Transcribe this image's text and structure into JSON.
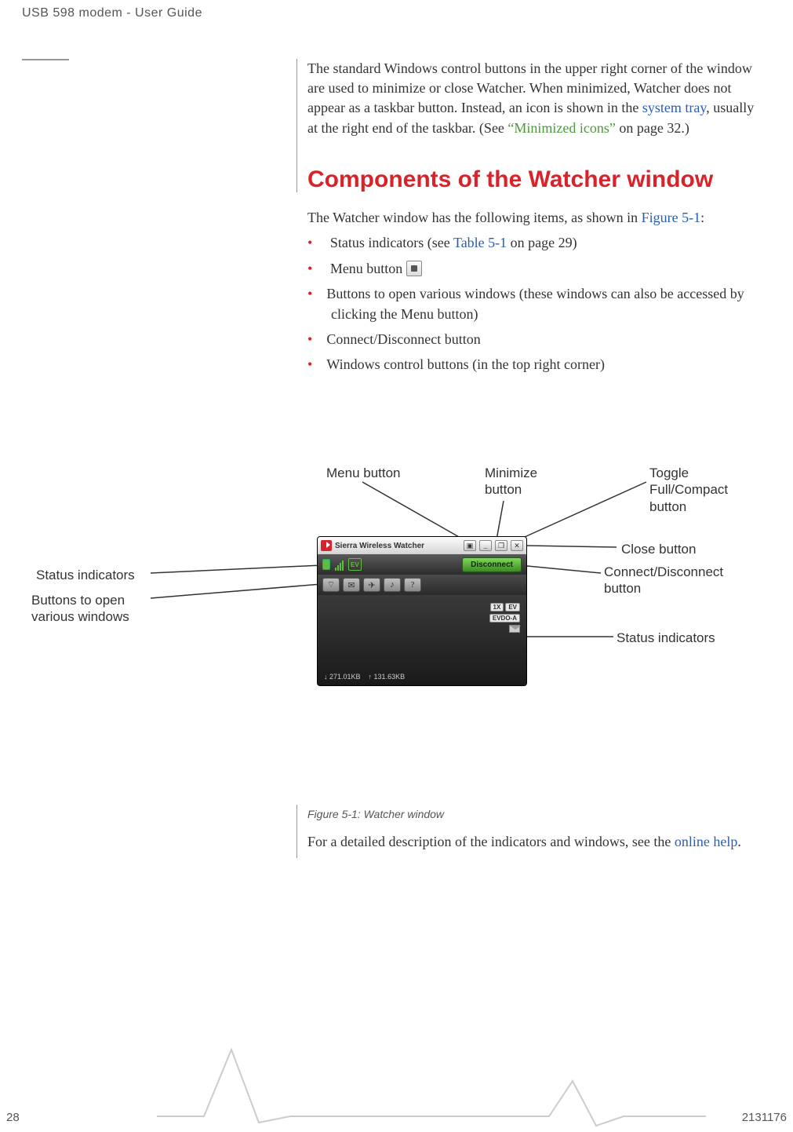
{
  "header": {
    "title": "USB 598 modem - User Guide"
  },
  "intro": {
    "p1a": "The standard Windows control buttons in the upper right corner of the window are used to minimize or close Watcher. When minimized, Watcher does not appear as a taskbar button. Instead, an icon is shown in the ",
    "link1": "system tray",
    "p1b": ", usually at the right end of the taskbar. (See ",
    "link2": "“Minimized icons”",
    "p1c": " on page 32.)"
  },
  "h1": "Components of the Watcher window",
  "lead": {
    "a": "The Watcher window has the following items, as shown in ",
    "link": "Figure 5-1",
    "b": ":"
  },
  "bullets": {
    "b0a": "Status indicators (see ",
    "b0link": "Table 5-1",
    "b0b": " on page 29)",
    "b1": "Menu button ",
    "b2": "Buttons to open various windows (these windows can also be accessed by clicking the Menu button)",
    "b3": "Connect/Disconnect button",
    "b4": "Windows control buttons (in the top right corner)"
  },
  "callouts": {
    "status_left": "Status indicators",
    "buttons_left": "Buttons to open various windows",
    "menu": "Menu button",
    "minimize": "Minimize button",
    "toggle": "Toggle Full/Compact button",
    "close": "Close button",
    "connect": "Connect/Disconnect button",
    "status_right": "Status indicators"
  },
  "app": {
    "title": "Sierra Wireless Watcher",
    "menu_glyph": "▣",
    "min_glyph": "_",
    "toggle_glyph": "❐",
    "close_glyph": "✕",
    "ev": "EV",
    "disconnect": "Disconnect",
    "tool_wifi": "⌔",
    "tool_chat": "✉",
    "tool_gps": "✈",
    "tool_music": "♪",
    "tool_help": "?",
    "badge_1x": "1X",
    "badge_ev": "EV",
    "badge_evdo": "EVDO-A",
    "down": "↓ 271.01KB",
    "up": "↑ 131.63KB"
  },
  "figcap": "Figure 5-1:  Watcher window",
  "closing": {
    "a": "For a detailed description of the indicators and windows, see the ",
    "link": "online help",
    "b": "."
  },
  "footer": {
    "page": "28",
    "docid": "2131176"
  }
}
